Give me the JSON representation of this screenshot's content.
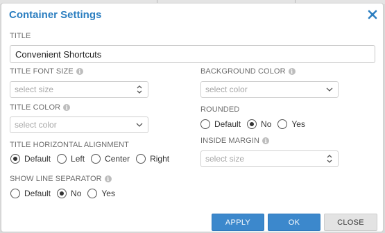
{
  "dialog": {
    "title": "Container Settings",
    "close_icon": "close-icon",
    "accent_color": "#2b7ec0"
  },
  "fields": {
    "title": {
      "label": "TITLE",
      "value": "Convenient Shortcuts"
    },
    "title_font_size": {
      "label": "TITLE FONT SIZE",
      "placeholder": "select size"
    },
    "title_color": {
      "label": "TITLE COLOR",
      "placeholder": "select color"
    },
    "title_alignment": {
      "label": "TITLE HORIZONTAL ALIGNMENT",
      "options": [
        "Default",
        "Left",
        "Center",
        "Right"
      ],
      "selected": "Default"
    },
    "show_line_separator": {
      "label": "SHOW LINE SEPARATOR",
      "options": [
        "Default",
        "No",
        "Yes"
      ],
      "selected": "No"
    },
    "background_color": {
      "label": "BACKGROUND COLOR",
      "placeholder": "select color"
    },
    "rounded": {
      "label": "ROUNDED",
      "options": [
        "Default",
        "No",
        "Yes"
      ],
      "selected": "No"
    },
    "inside_margin": {
      "label": "INSIDE MARGIN",
      "placeholder": "select size"
    }
  },
  "buttons": {
    "apply": "APPLY",
    "ok": "OK",
    "close": "CLOSE"
  }
}
